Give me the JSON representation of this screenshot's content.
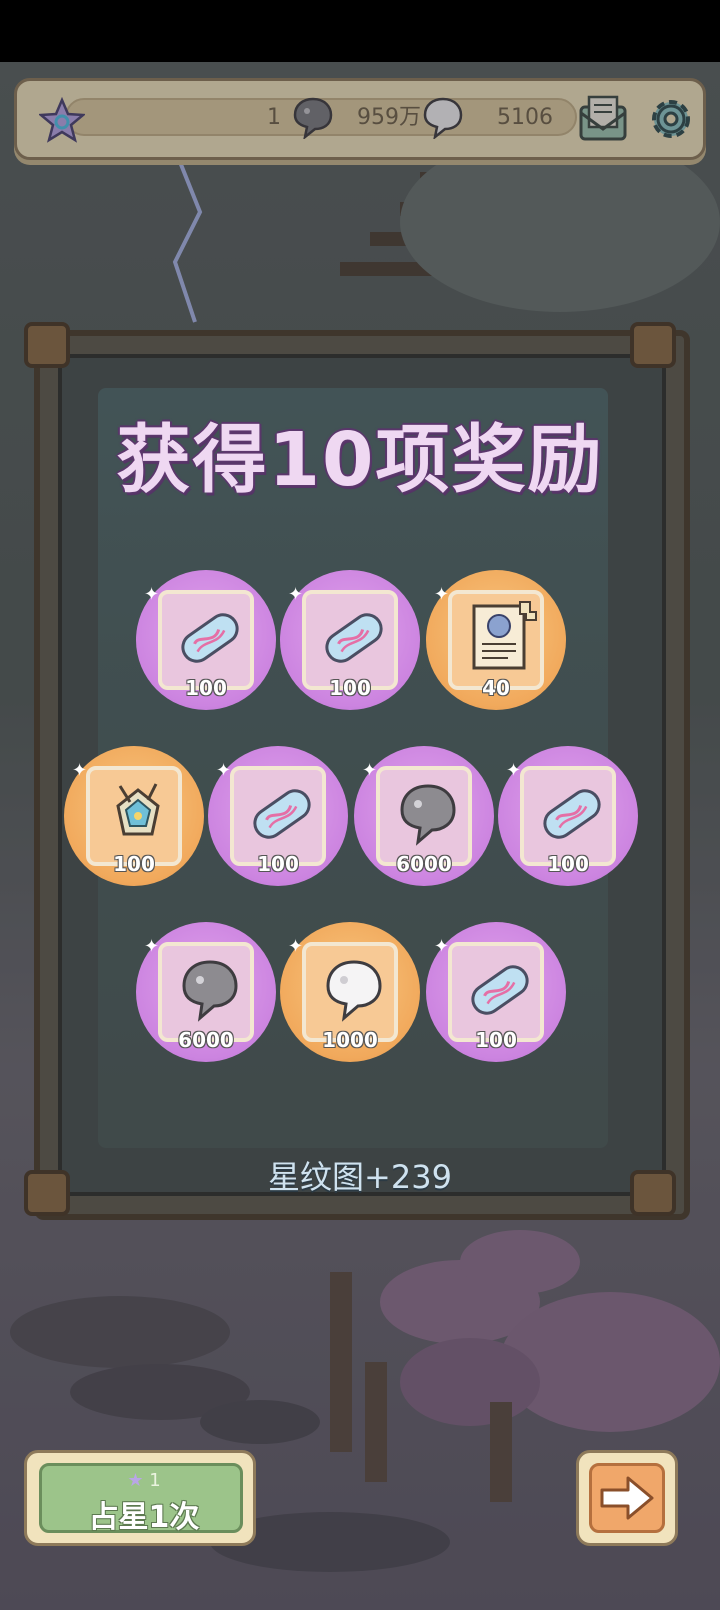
{
  "topbar": {
    "level": "1",
    "currency_a": "959万",
    "currency_b": "5106",
    "icons": [
      "star-icon",
      "blob-currency-icon",
      "speech-bubble-currency-icon",
      "mail-icon",
      "gear-icon"
    ]
  },
  "dialog": {
    "title": "获得10项奖励",
    "summary": "星纹图+239"
  },
  "rewards": [
    {
      "icon": "capsule-icon",
      "qty": "100",
      "rarity": "purple"
    },
    {
      "icon": "capsule-icon",
      "qty": "100",
      "rarity": "purple"
    },
    {
      "icon": "scroll-icon",
      "qty": "40",
      "rarity": "orange"
    },
    {
      "icon": "relic-icon",
      "qty": "100",
      "rarity": "orange"
    },
    {
      "icon": "capsule-icon",
      "qty": "100",
      "rarity": "purple"
    },
    {
      "icon": "blob-icon",
      "qty": "6000",
      "rarity": "purple"
    },
    {
      "icon": "capsule-icon",
      "qty": "100",
      "rarity": "purple"
    },
    {
      "icon": "blob-icon",
      "qty": "6000",
      "rarity": "purple"
    },
    {
      "icon": "speech-blob-icon",
      "qty": "1000",
      "rarity": "orange"
    },
    {
      "icon": "capsule-icon",
      "qty": "100",
      "rarity": "purple"
    }
  ],
  "bottom": {
    "cost": "1",
    "action_label": "占星1次",
    "next_icon": "arrow-right-icon"
  },
  "colors": {
    "purple": "#cc84e0",
    "orange": "#f1a95c",
    "cream": "#f1e3bd",
    "title": "#efd8f2"
  }
}
